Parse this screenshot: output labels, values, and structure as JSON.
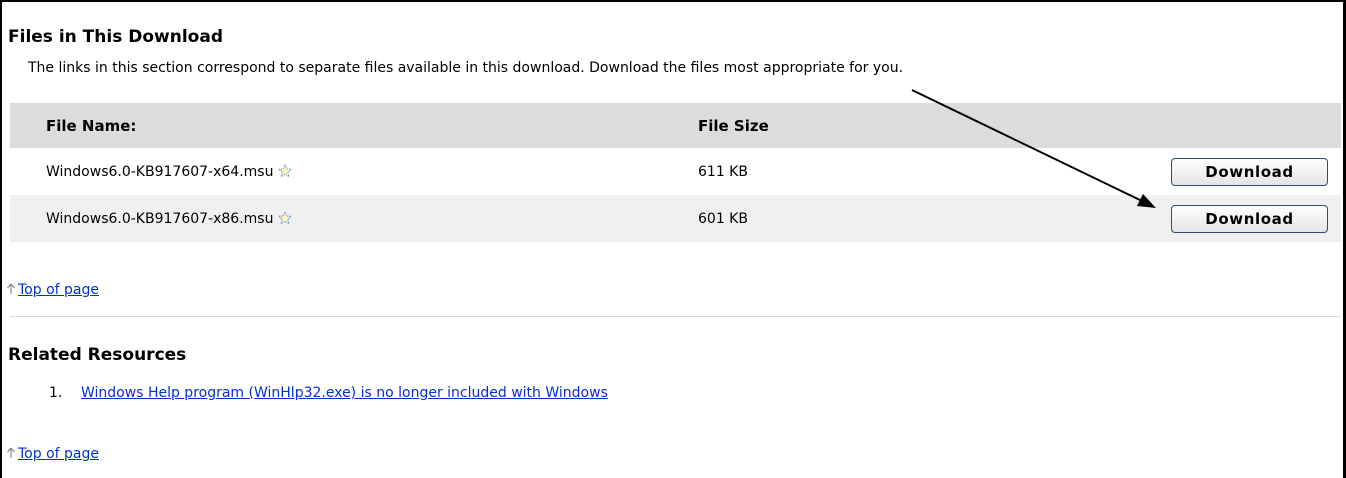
{
  "files_section": {
    "heading": "Files in This Download",
    "intro": "The links in this section correspond to separate files available in this download. Download the files most appropriate for you.",
    "columns": {
      "name": "File Name:",
      "size": "File Size"
    },
    "rows": [
      {
        "name": "Windows6.0-KB917607-x64.msu",
        "size": "611 KB",
        "button": "Download"
      },
      {
        "name": "Windows6.0-KB917607-x86.msu",
        "size": "601 KB",
        "button": "Download"
      }
    ]
  },
  "top_of_page": "Top of page",
  "related": {
    "heading": "Related Resources",
    "items": [
      {
        "number": "1.",
        "label": "Windows Help program (WinHlp32.exe) is no longer included with Windows"
      }
    ]
  },
  "colors": {
    "link": "#0033cc",
    "header_row": "#dcdcdc",
    "alt_row": "#f0f0f0",
    "button_border": "#2c4a7a"
  }
}
